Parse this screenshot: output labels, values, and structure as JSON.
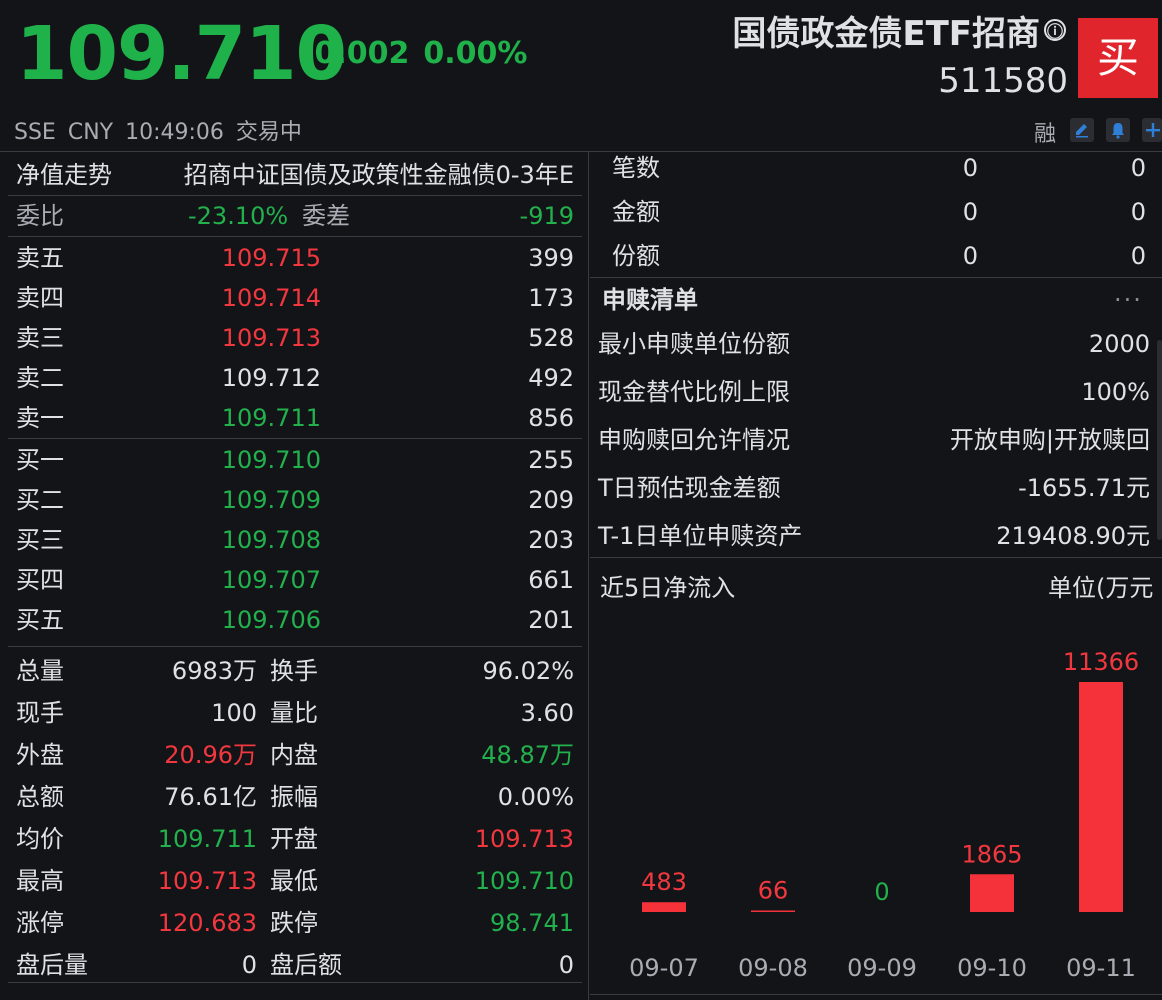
{
  "header": {
    "price": "109.710",
    "change": "-0.002",
    "change_pct": "0.00%",
    "title": "国债政金债ETF招商",
    "info_icon": "ⓘ",
    "code": "511580",
    "buy_label": "买",
    "exchange": "SSE",
    "currency": "CNY",
    "time": "10:49:06",
    "trade_status": "交易中",
    "margin_tag": "融"
  },
  "nav": {
    "label": "净值走势",
    "fund_name": "招商中证国债及政策性金融债0-3年E"
  },
  "ratio": {
    "label": "委比",
    "value": "-23.10%",
    "diff_label": "委差",
    "diff_value": "-919"
  },
  "asks": [
    {
      "label": "卖五",
      "price": "109.715",
      "volume": "399",
      "color": "red"
    },
    {
      "label": "卖四",
      "price": "109.714",
      "volume": "173",
      "color": "red"
    },
    {
      "label": "卖三",
      "price": "109.713",
      "volume": "528",
      "color": "red"
    },
    {
      "label": "卖二",
      "price": "109.712",
      "volume": "492",
      "color": "white"
    },
    {
      "label": "卖一",
      "price": "109.711",
      "volume": "856",
      "color": "green"
    }
  ],
  "bids": [
    {
      "label": "买一",
      "price": "109.710",
      "volume": "255",
      "color": "green"
    },
    {
      "label": "买二",
      "price": "109.709",
      "volume": "209",
      "color": "green"
    },
    {
      "label": "买三",
      "price": "109.708",
      "volume": "203",
      "color": "green"
    },
    {
      "label": "买四",
      "price": "109.707",
      "volume": "661",
      "color": "green"
    },
    {
      "label": "买五",
      "price": "109.706",
      "volume": "201",
      "color": "green"
    }
  ],
  "stats": [
    {
      "l1": "总量",
      "v1": "6983万",
      "c1": "white",
      "l2": "换手",
      "v2": "96.02%",
      "c2": "white"
    },
    {
      "l1": "现手",
      "v1": "100",
      "c1": "white",
      "l2": "量比",
      "v2": "3.60",
      "c2": "white"
    },
    {
      "l1": "外盘",
      "v1": "20.96万",
      "c1": "red",
      "l2": "内盘",
      "v2": "48.87万",
      "c2": "green"
    },
    {
      "l1": "总额",
      "v1": "76.61亿",
      "c1": "white",
      "l2": "振幅",
      "v2": "0.00%",
      "c2": "white"
    },
    {
      "l1": "均价",
      "v1": "109.711",
      "c1": "green",
      "l2": "开盘",
      "v2": "109.713",
      "c2": "red"
    },
    {
      "l1": "最高",
      "v1": "109.713",
      "c1": "red",
      "l2": "最低",
      "v2": "109.710",
      "c2": "green"
    },
    {
      "l1": "涨停",
      "v1": "120.683",
      "c1": "red",
      "l2": "跌停",
      "v2": "98.741",
      "c2": "green"
    },
    {
      "l1": "盘后量",
      "v1": "0",
      "c1": "white",
      "l2": "盘后额",
      "v2": "0",
      "c2": "white"
    }
  ],
  "trades": [
    {
      "label": "笔数",
      "v1": "0",
      "v2": "0"
    },
    {
      "label": "金额",
      "v1": "0",
      "v2": "0"
    },
    {
      "label": "份额",
      "v1": "0",
      "v2": "0"
    }
  ],
  "creation": {
    "title": "申赎清单",
    "more_icon": "···",
    "items": [
      {
        "k": "最小申赎单位份额",
        "v": "2000"
      },
      {
        "k": "现金替代比例上限",
        "v": "100%"
      },
      {
        "k": "申购赎回允许情况",
        "v": "开放申购|开放赎回"
      },
      {
        "k": "T日预估现金差额",
        "v": "-1655.71元"
      },
      {
        "k": "T-1日单位申赎资产",
        "v": "219408.90元"
      }
    ]
  },
  "colors": {
    "up": "#f2383e",
    "down": "#22b14c",
    "bar": "#f5323a",
    "background": "#131418"
  },
  "chart_data": {
    "type": "bar",
    "title": "近5日净流入",
    "unit_label": "单位(万元",
    "categories": [
      "09-07",
      "09-08",
      "09-09",
      "09-10",
      "09-11"
    ],
    "values": [
      483,
      66,
      0,
      1865,
      11366
    ],
    "labels": [
      "483",
      "66",
      "0",
      "1865",
      "11366"
    ]
  }
}
